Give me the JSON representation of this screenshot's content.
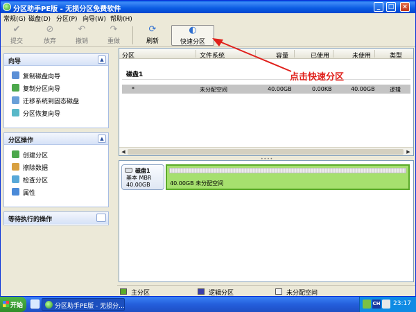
{
  "window": {
    "title": "分区助手PE版 - 无损分区免费软件"
  },
  "menu": [
    "常规(G)",
    "磁盘(D)",
    "分区(P)",
    "向导(W)",
    "帮助(H)"
  ],
  "toolbar": {
    "submit": "提交",
    "discard": "放弃",
    "undo": "撤销",
    "redo": "重做",
    "refresh": "刷新",
    "quick_partition": "快速分区"
  },
  "left": {
    "wizard": {
      "title": "向导",
      "items": [
        "复制磁盘向导",
        "复制分区向导",
        "迁移系统到固态磁盘",
        "分区恢复向导"
      ]
    },
    "partition_ops": {
      "title": "分区操作",
      "items": [
        "创建分区",
        "擦除数据",
        "检查分区",
        "属性"
      ]
    },
    "pending": {
      "title": "等待执行的操作"
    }
  },
  "table": {
    "columns": [
      "分区",
      "文件系统",
      "容量",
      "已使用",
      "未使用",
      "类型"
    ],
    "disk_label": "磁盘1",
    "rows": [
      {
        "partition": "*",
        "fs": "未分配空间",
        "capacity": "40.00GB",
        "used": "0.00KB",
        "free": "40.00GB",
        "type": "逻辑"
      }
    ]
  },
  "disk_map": {
    "name": "磁盘1",
    "type": "基本 MBR",
    "size": "40.00GB",
    "partition_label": "40.00GB 未分配空间"
  },
  "legend": [
    "主分区",
    "逻辑分区",
    "未分配空间"
  ],
  "annotation": "点击快速分区",
  "taskbar": {
    "start": "开始",
    "task": "分区助手PE版 - 无损分...",
    "lang": "CH",
    "clock": "23:17"
  },
  "colors": {
    "primary": "#5aaa2a",
    "logical": "#3b3fa8",
    "unallocated": "#f2f2f2",
    "annotation": "#e0201b"
  }
}
